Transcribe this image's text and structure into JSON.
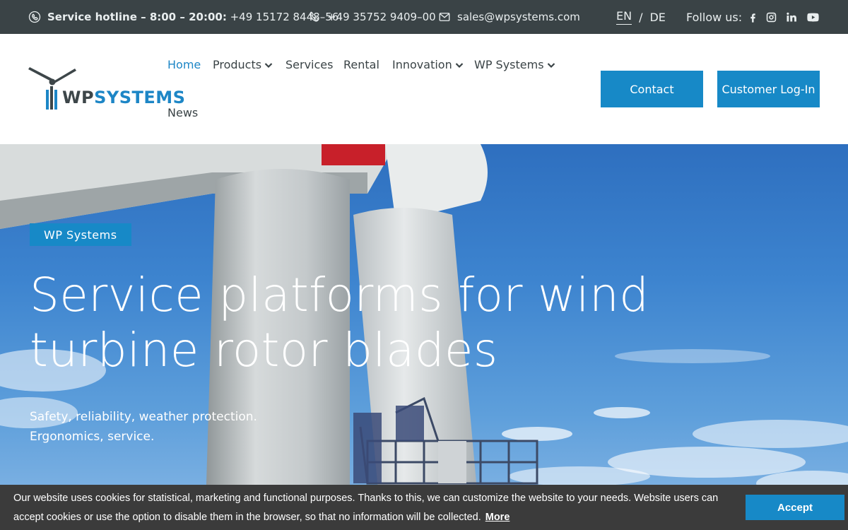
{
  "topbar": {
    "hotline_label": "Service hotline – 8:00 – 20:00:",
    "hotline_number": "+49 15172 8448–56",
    "phone2": "+49 35752 9409–00",
    "email": "sales@wpsystems.com",
    "lang_en": "EN",
    "lang_sep": "/",
    "lang_de": "DE",
    "follow_label": "Follow us:",
    "social_icons": [
      "facebook-icon",
      "instagram-icon",
      "linkedin-icon",
      "youtube-icon"
    ]
  },
  "header": {
    "logo_wp": "WP",
    "logo_systems": "SYSTEMS",
    "nav": {
      "home": "Home",
      "products": "Products",
      "services": "Services",
      "rental": "Rental",
      "innovation": "Innovation",
      "wpsystems": "WP Systems",
      "news": "News"
    },
    "contact_label": "Contact",
    "login_label": "Customer Log-In"
  },
  "hero": {
    "tag": "WP Systems",
    "title_line1": "Service platforms for wind",
    "title_line2": "turbine rotor blades",
    "sub_line1": "Safety, reliability, weather protection.",
    "sub_line2": "Ergonomics, service."
  },
  "cookie": {
    "text": "Our website uses cookies for statistical, marketing and functional purposes. Thanks to this, we can customize the website to your needs. Website users can accept cookies or use the option to disable them in the browser, so that no information will be collected.",
    "more": "More",
    "accept": "Accept"
  },
  "colors": {
    "accent": "#1789c7",
    "topbar": "#3a4346",
    "cookie_bg": "#3b3b3b"
  }
}
